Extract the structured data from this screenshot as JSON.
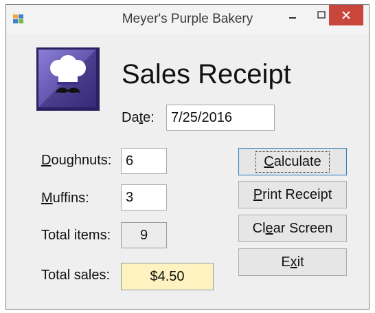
{
  "window": {
    "title": "Meyer's Purple Bakery"
  },
  "heading": "Sales Receipt",
  "date": {
    "label_pre": "Da",
    "label_key": "t",
    "label_post": "e:",
    "value": "7/25/2016"
  },
  "doughnuts": {
    "label_key": "D",
    "label_rest": "oughnuts:",
    "value": "6"
  },
  "muffins": {
    "label_key": "M",
    "label_rest": "uffins:",
    "value": "3"
  },
  "total_items": {
    "label": "Total items:",
    "value": "9"
  },
  "total_sales": {
    "label": "Total sales:",
    "value": "$4.50"
  },
  "buttons": {
    "calculate": {
      "key": "C",
      "rest": "alculate"
    },
    "print": {
      "key": "P",
      "rest": "rint Receipt"
    },
    "clear": {
      "pre": "Cl",
      "key": "e",
      "rest": "ar Screen"
    },
    "exit": {
      "pre": "E",
      "key": "x",
      "rest": "it"
    }
  },
  "colors": {
    "close_button": "#c9463d",
    "total_sales_bg": "#fdf2c0",
    "logo_purple": "#5b4ea8"
  }
}
